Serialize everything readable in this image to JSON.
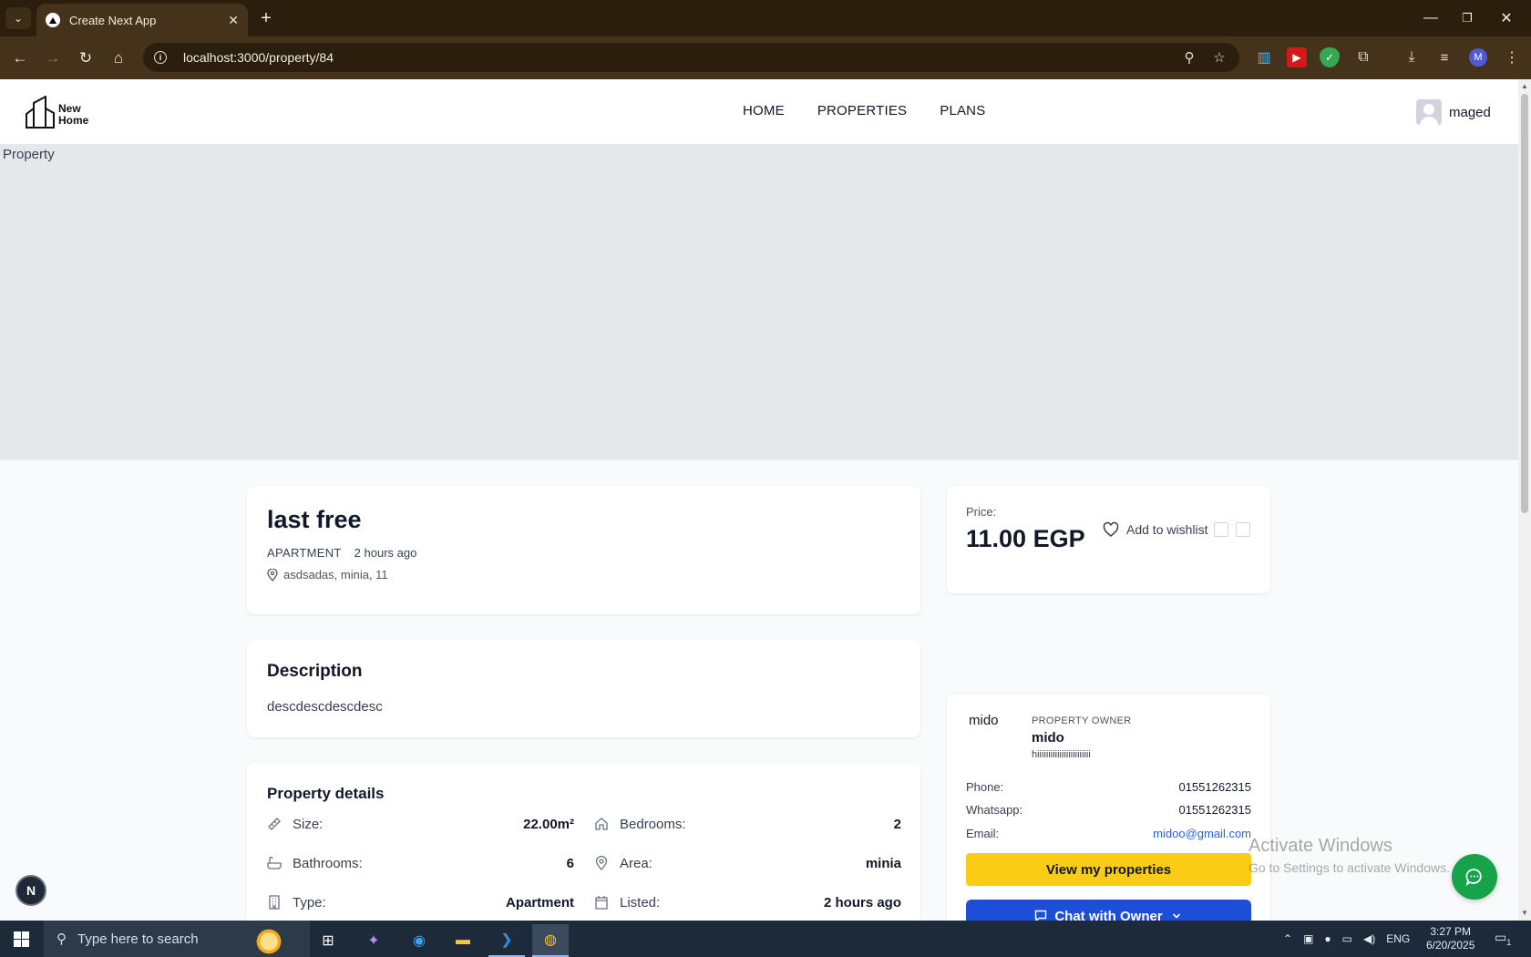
{
  "browser": {
    "tab_title": "Create Next App",
    "tab_close": "✕",
    "new_tab": "+",
    "url": "localhost:3000/property/84",
    "profile_initial": "M",
    "window_controls": [
      "—",
      "❐",
      "✕"
    ]
  },
  "site": {
    "logo_line1": "New",
    "logo_line2": "Home",
    "nav": [
      "HOME",
      "PROPERTIES",
      "PLANS"
    ],
    "user_name": "maged"
  },
  "hero": {
    "image_alt": "Property"
  },
  "property": {
    "title": "last free",
    "type": "APARTMENT",
    "posted": "2 hours ago",
    "address": "asdsadas, minia, 11"
  },
  "description": {
    "heading": "Description",
    "text": "descdescdescdesc"
  },
  "details": {
    "heading": "Property details",
    "items": [
      {
        "label": "Size:",
        "value": "22.00m²",
        "icon": "ruler-icon"
      },
      {
        "label": "Bedrooms:",
        "value": "2",
        "icon": "home-icon"
      },
      {
        "label": "Bathrooms:",
        "value": "6",
        "icon": "bath-icon"
      },
      {
        "label": "Area:",
        "value": "minia",
        "icon": "map-pin-icon"
      },
      {
        "label": "Type:",
        "value": "Apartment",
        "icon": "building-icon"
      },
      {
        "label": "Listed:",
        "value": "2 hours ago",
        "icon": "calendar-icon"
      }
    ]
  },
  "price": {
    "label": "Price:",
    "value": "11.00 EGP",
    "wishlist_label": "Add to wishlist"
  },
  "owner": {
    "photo_alt": "mido",
    "role": "PROPERTY OWNER",
    "name": "mido",
    "bio": "hiiiiiiiiiiiiiiiiiiiiiiii",
    "phone_label": "Phone:",
    "phone": "01551262315",
    "whatsapp_label": "Whatsapp:",
    "whatsapp": "01551262315",
    "email_label": "Email:",
    "email": "midoo@gmail.com",
    "view_button": "View my properties",
    "chat_button": "Chat with Owner"
  },
  "overlay": {
    "watermark_line1": "Activate Windows",
    "watermark_line2": "Go to Settings to activate Windows.",
    "next_badge": "N"
  },
  "taskbar": {
    "search_placeholder": "Type here to search",
    "language": "ENG",
    "time": "3:27 PM",
    "date": "6/20/2025",
    "notification_count": "1"
  },
  "colors": {
    "browser_frame": "#45321a",
    "accent_yellow": "#facc15",
    "accent_blue": "#1d4ed8",
    "fab_green": "#16a34a",
    "link_blue": "#2563eb"
  }
}
